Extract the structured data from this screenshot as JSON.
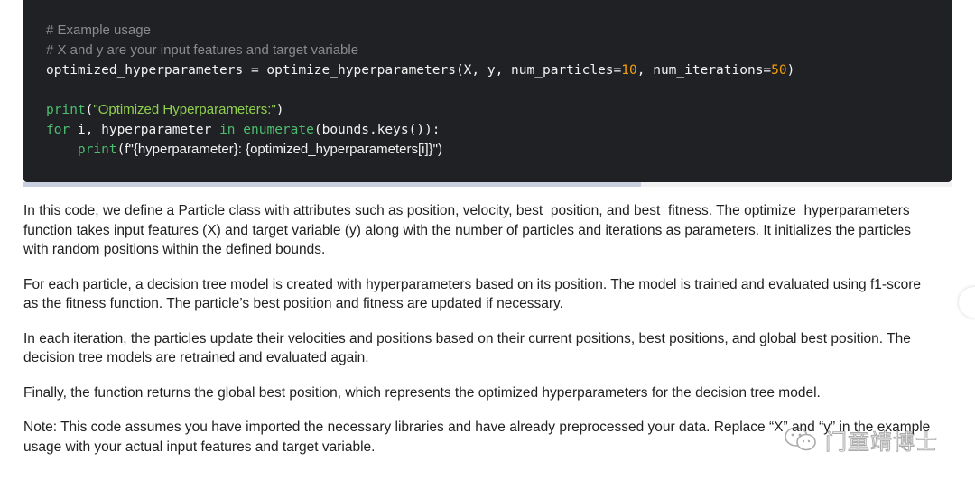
{
  "code": {
    "comment1": "# Example usage",
    "comment2": "# X and y are your input features and target variable",
    "line3_a": "optimized_hyperparameters = optimize_hyperparameters(X, y, num_particles=",
    "line3_num1": "10",
    "line3_b": ", num_iterations=",
    "line3_num2": "50",
    "line3_c": ")",
    "line5_fn": "print",
    "line5_paren_open": "(",
    "line5_str": "\"Optimized Hyperparameters:\"",
    "line5_paren_close": ")",
    "line6_for": "for",
    "line6_a": " i, hyperparameter ",
    "line6_in": "in",
    "line6_space": " ",
    "line6_enum": "enumerate",
    "line6_b": "(bounds.keys()):",
    "line7_indent": "    ",
    "line7_fn": "print",
    "line7_paren": "(",
    "line7_fprefix": "f\"",
    "line7_body": "{hyperparameter}: {optimized_hyperparameters[i]}",
    "line7_end": "\")"
  },
  "prose": {
    "p1": "In this code, we define a Particle class with attributes such as position, velocity, best_position, and best_fitness. The optimize_hyperparameters function takes input features (X) and target variable (y) along with the number of particles and iterations as parameters. It initializes the particles with random positions within the defined bounds.",
    "p2": "For each particle, a decision tree model is created with hyperparameters based on its position. The model is trained and evaluated using f1-score as the fitness function. The particle’s best position and fitness are updated if necessary.",
    "p3": "In each iteration, the particles update their velocities and positions based on their current positions, best positions, and global best position. The decision tree models are retrained and evaluated again.",
    "p4": "Finally, the function returns the global best position, which represents the optimized hyperparameters for the decision tree model.",
    "p5": "Note: This code assumes you have imported the necessary libraries and have already preprocessed your data. Replace “X” and “y” in the example usage with your actual input features and target variable."
  },
  "watermark": {
    "text": "门童靖博士",
    "icon": "wechat-icon"
  },
  "colors": {
    "code_bg": "#202124",
    "comment": "#8a8b8d",
    "keyword": "#4cbf6f",
    "number": "#f59e0b",
    "string": "#8fd14f"
  }
}
